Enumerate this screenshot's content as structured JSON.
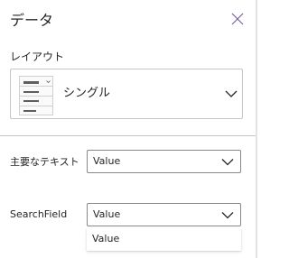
{
  "panel": {
    "title": "データ",
    "close_icon": "close-icon"
  },
  "layout": {
    "label": "レイアウト",
    "selected": "シングル",
    "thumbnail_icon": "single-layout-thumbnail-icon"
  },
  "fields": [
    {
      "label": "主要なテキスト",
      "value": "Value"
    },
    {
      "label": "SearchField",
      "value": "Value"
    }
  ],
  "dropdown": {
    "options": [
      "Value"
    ]
  },
  "colors": {
    "accent": "#7b5fa3",
    "border": "#8a8886",
    "text": "#252423"
  }
}
